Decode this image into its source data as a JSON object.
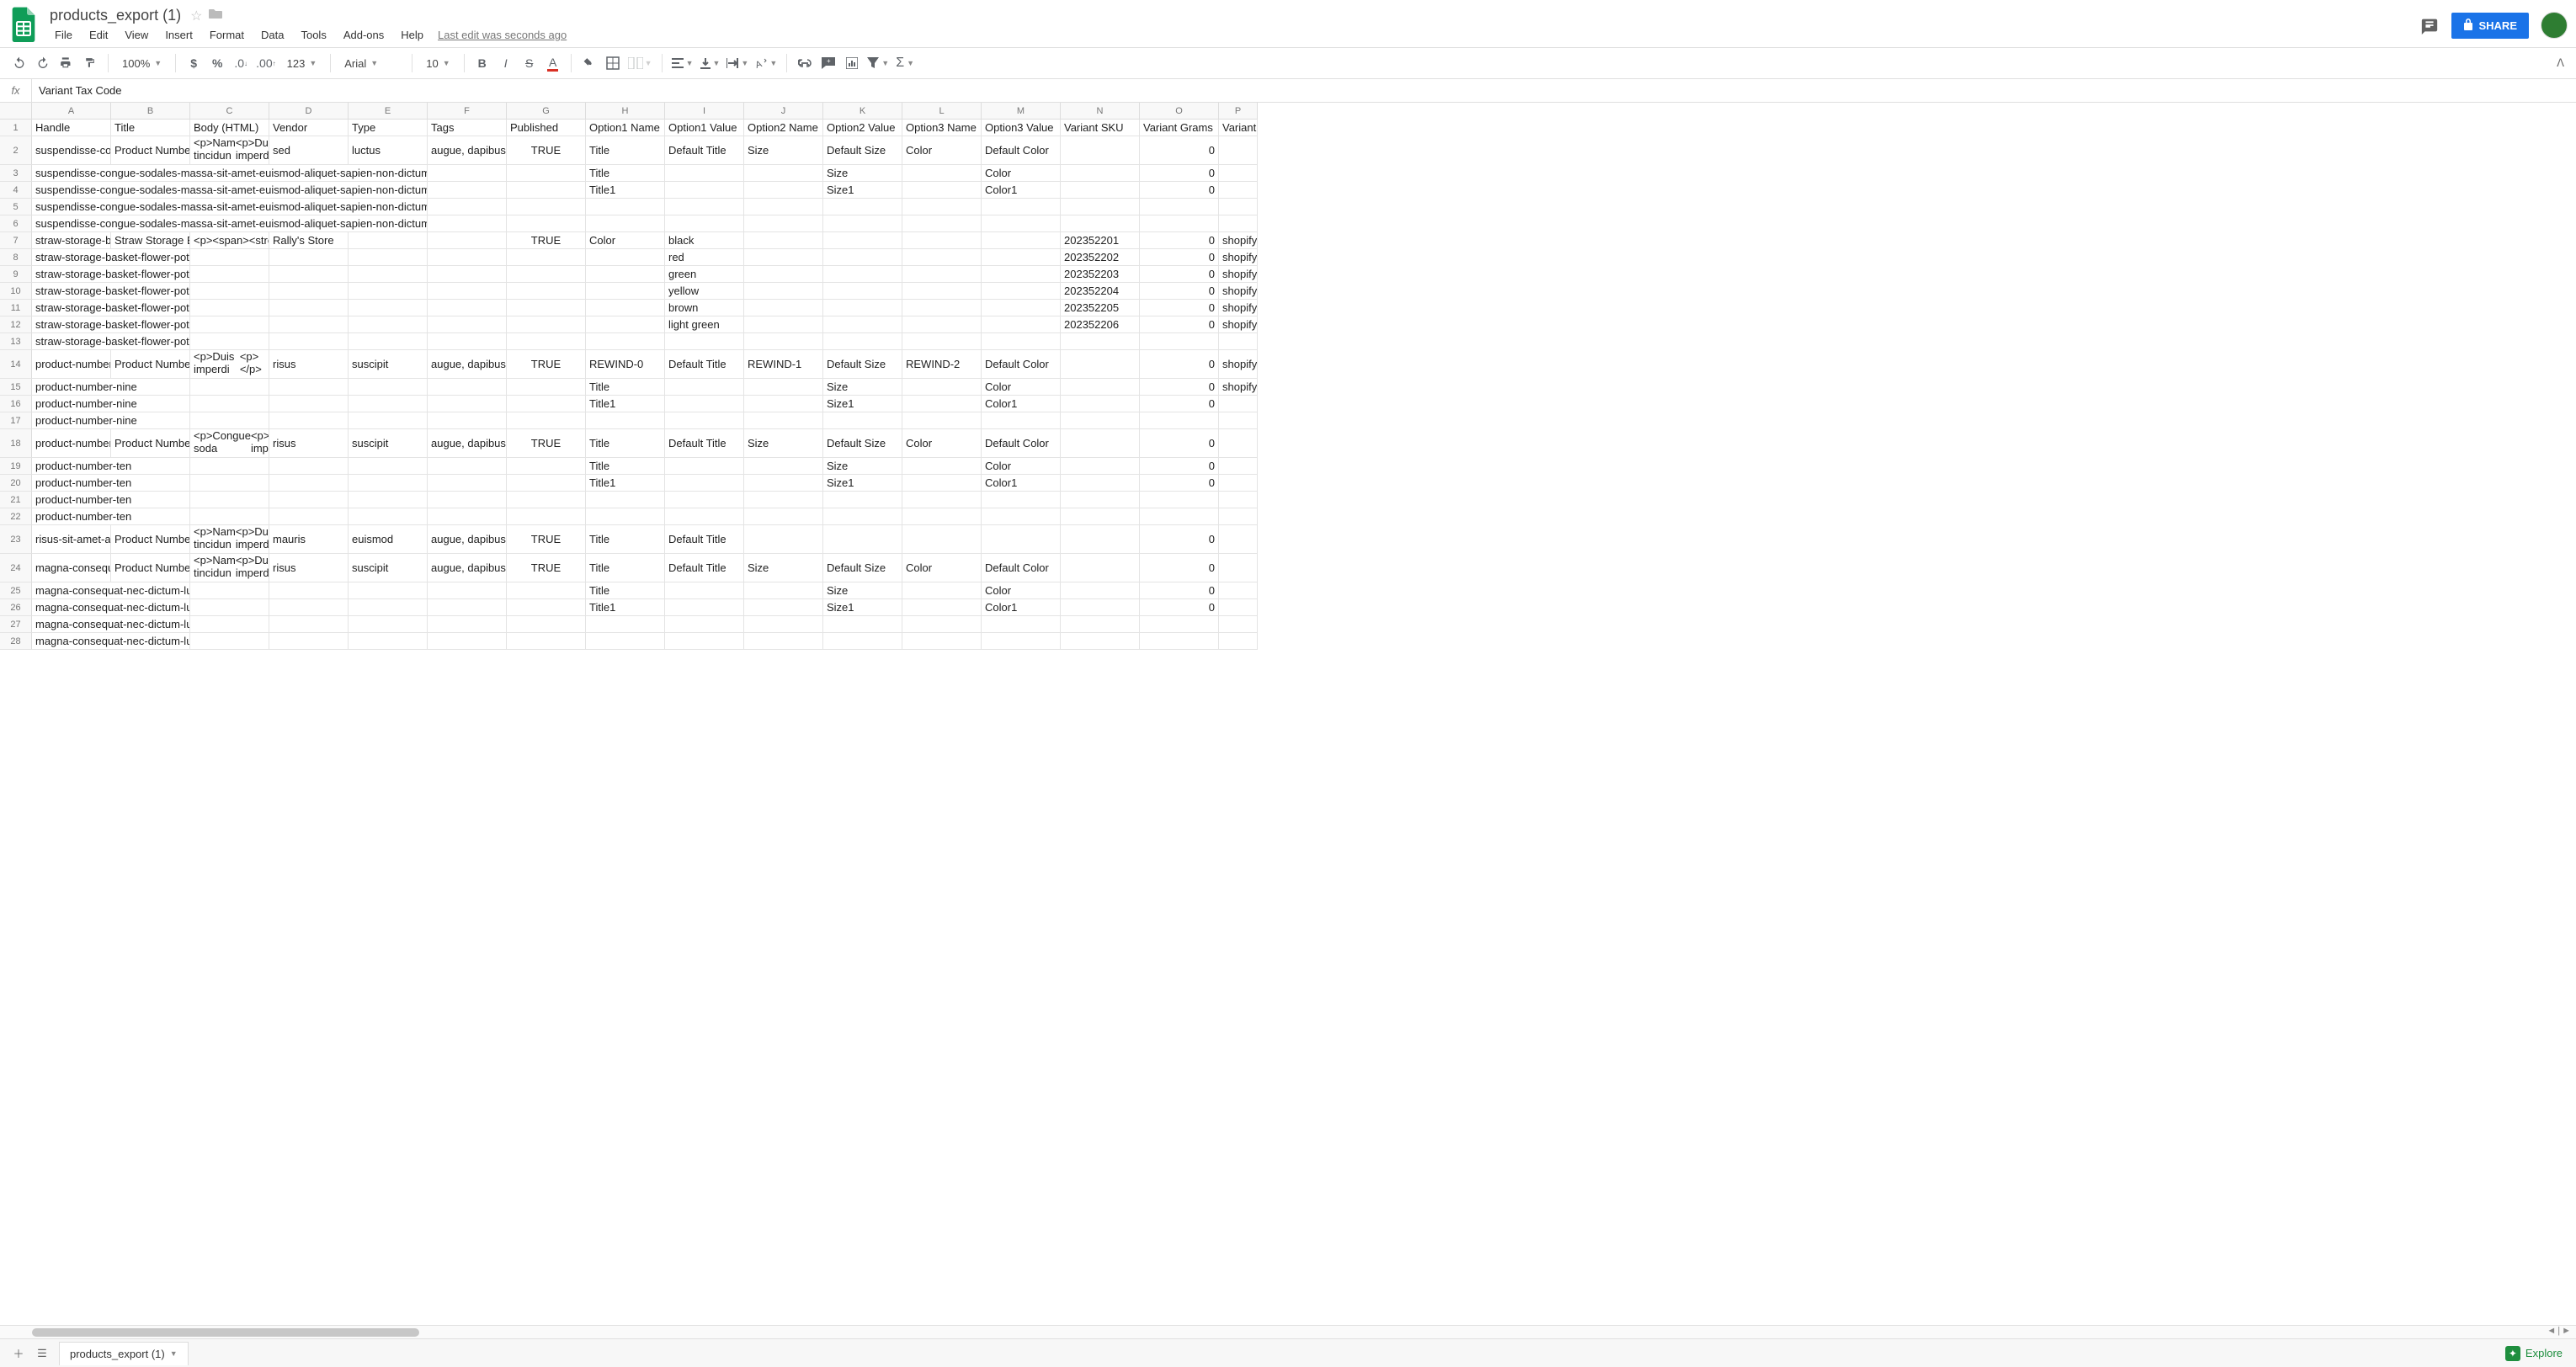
{
  "doc": {
    "title": "products_export (1)",
    "last_edit": "Last edit was seconds ago"
  },
  "menus": [
    "File",
    "Edit",
    "View",
    "Insert",
    "Format",
    "Data",
    "Tools",
    "Add-ons",
    "Help"
  ],
  "share_label": "SHARE",
  "toolbar": {
    "zoom": "100%",
    "font": "Arial",
    "font_size": "10",
    "num_fmt": "123"
  },
  "formula_bar": {
    "fx": "fx",
    "value": "Variant Tax Code"
  },
  "columns": [
    {
      "letter": "A",
      "label": "Handle",
      "w": 94
    },
    {
      "letter": "B",
      "label": "Title",
      "w": 94
    },
    {
      "letter": "C",
      "label": "Body (HTML)",
      "w": 94
    },
    {
      "letter": "D",
      "label": "Vendor",
      "w": 94
    },
    {
      "letter": "E",
      "label": "Type",
      "w": 94
    },
    {
      "letter": "F",
      "label": "Tags",
      "w": 94
    },
    {
      "letter": "G",
      "label": "Published",
      "w": 94
    },
    {
      "letter": "H",
      "label": "Option1 Name",
      "w": 94
    },
    {
      "letter": "I",
      "label": "Option1 Value",
      "w": 94
    },
    {
      "letter": "J",
      "label": "Option2 Name",
      "w": 94
    },
    {
      "letter": "K",
      "label": "Option2 Value",
      "w": 94
    },
    {
      "letter": "L",
      "label": "Option3 Name",
      "w": 94
    },
    {
      "letter": "M",
      "label": "Option3 Value",
      "w": 94
    },
    {
      "letter": "N",
      "label": "Variant SKU",
      "w": 94
    },
    {
      "letter": "O",
      "label": "Variant Grams",
      "w": 94
    },
    {
      "letter": "P",
      "label": "Variant I",
      "w": 46
    }
  ],
  "rowhead_w": 38,
  "rows": [
    {
      "n": 1,
      "h": 20,
      "header": true
    },
    {
      "n": 2,
      "h": 34,
      "cells": [
        "suspendisse-con",
        "Product Number",
        "<p>Nam tincidun\n<p>Duis imperdi",
        "sed",
        "luctus",
        "augue, dapibus,",
        "TRUE",
        "Title",
        "Default Title",
        "Size",
        "Default Size",
        "Color",
        "Default Color",
        "",
        "0",
        ""
      ]
    },
    {
      "n": 3,
      "h": 20,
      "cells": [
        "suspendisse-congue-sodales-massa-sit-amet-euismod-aliquet-sapien-non-dictum",
        "",
        "",
        "",
        "",
        "",
        "",
        "Title",
        "",
        "",
        "Size",
        "",
        "Color",
        "",
        "0",
        ""
      ],
      "span": 5
    },
    {
      "n": 4,
      "h": 20,
      "cells": [
        "suspendisse-congue-sodales-massa-sit-amet-euismod-aliquet-sapien-non-dictum",
        "",
        "",
        "",
        "",
        "",
        "",
        "Title1",
        "",
        "",
        "Size1",
        "",
        "Color1",
        "",
        "0",
        ""
      ],
      "span": 5
    },
    {
      "n": 5,
      "h": 20,
      "cells": [
        "suspendisse-congue-sodales-massa-sit-amet-euismod-aliquet-sapien-non-dictum",
        "",
        "",
        "",
        "",
        "",
        "",
        "",
        "",
        "",
        "",
        "",
        "",
        "",
        "",
        ""
      ],
      "span": 5
    },
    {
      "n": 6,
      "h": 20,
      "cells": [
        "suspendisse-congue-sodales-massa-sit-amet-euismod-aliquet-sapien-non-dictum",
        "",
        "",
        "",
        "",
        "",
        "",
        "",
        "",
        "",
        "",
        "",
        "",
        "",
        "",
        ""
      ],
      "span": 5
    },
    {
      "n": 7,
      "h": 20,
      "cells": [
        "straw-storage-ba",
        "Straw Storage Ba",
        "<p><span><stro",
        "Rally's Store",
        "",
        "",
        "TRUE",
        "Color",
        "black",
        "",
        "",
        "",
        "",
        "202352201",
        "0",
        "shopify"
      ]
    },
    {
      "n": 8,
      "h": 20,
      "cells": [
        "straw-storage-basket-flower-pot",
        "",
        "",
        "",
        "",
        "",
        "",
        "",
        "red",
        "",
        "",
        "",
        "",
        "202352202",
        "0",
        "shopify"
      ],
      "span": 2
    },
    {
      "n": 9,
      "h": 20,
      "cells": [
        "straw-storage-basket-flower-pot",
        "",
        "",
        "",
        "",
        "",
        "",
        "",
        "green",
        "",
        "",
        "",
        "",
        "202352203",
        "0",
        "shopify"
      ],
      "span": 2
    },
    {
      "n": 10,
      "h": 20,
      "cells": [
        "straw-storage-basket-flower-pot",
        "",
        "",
        "",
        "",
        "",
        "",
        "",
        "yellow",
        "",
        "",
        "",
        "",
        "202352204",
        "0",
        "shopify"
      ],
      "span": 2
    },
    {
      "n": 11,
      "h": 20,
      "cells": [
        "straw-storage-basket-flower-pot",
        "",
        "",
        "",
        "",
        "",
        "",
        "",
        "brown",
        "",
        "",
        "",
        "",
        "202352205",
        "0",
        "shopify"
      ],
      "span": 2
    },
    {
      "n": 12,
      "h": 20,
      "cells": [
        "straw-storage-basket-flower-pot",
        "",
        "",
        "",
        "",
        "",
        "",
        "",
        "light green",
        "",
        "",
        "",
        "",
        "202352206",
        "0",
        "shopify"
      ],
      "span": 2
    },
    {
      "n": 13,
      "h": 20,
      "cells": [
        "straw-storage-basket-flower-pot",
        "",
        "",
        "",
        "",
        "",
        "",
        "",
        "",
        "",
        "",
        "",
        "",
        "",
        "",
        ""
      ],
      "span": 2
    },
    {
      "n": 14,
      "h": 34,
      "cells": [
        "product-number-",
        "Product Number",
        "<p>Duis imperdi\n<p> </p>",
        "risus",
        "suscipit",
        "augue, dapibus,",
        "TRUE",
        "REWIND-0",
        "Default Title",
        "REWIND-1",
        "Default Size",
        "REWIND-2",
        "Default Color",
        "",
        "0",
        "shopify"
      ]
    },
    {
      "n": 15,
      "h": 20,
      "cells": [
        "product-number-nine",
        "",
        "",
        "",
        "",
        "",
        "",
        "Title",
        "",
        "",
        "Size",
        "",
        "Color",
        "",
        "0",
        "shopify"
      ],
      "span": 2
    },
    {
      "n": 16,
      "h": 20,
      "cells": [
        "product-number-nine",
        "",
        "",
        "",
        "",
        "",
        "",
        "Title1",
        "",
        "",
        "Size1",
        "",
        "Color1",
        "",
        "0",
        ""
      ],
      "span": 2
    },
    {
      "n": 17,
      "h": 20,
      "cells": [
        "product-number-nine",
        "",
        "",
        "",
        "",
        "",
        "",
        "",
        "",
        "",
        "",
        "",
        "",
        "",
        "",
        ""
      ],
      "span": 2
    },
    {
      "n": 18,
      "h": 34,
      "cells": [
        "product-number-",
        "Product Number",
        "<p>Congue soda\n<p>Duis imperdi",
        "risus",
        "suscipit",
        "augue, dapibus,",
        "TRUE",
        "Title",
        "Default Title",
        "Size",
        "Default Size",
        "Color",
        "Default Color",
        "",
        "0",
        ""
      ]
    },
    {
      "n": 19,
      "h": 20,
      "cells": [
        "product-number-ten",
        "",
        "",
        "",
        "",
        "",
        "",
        "Title",
        "",
        "",
        "Size",
        "",
        "Color",
        "",
        "0",
        ""
      ],
      "span": 2
    },
    {
      "n": 20,
      "h": 20,
      "cells": [
        "product-number-ten",
        "",
        "",
        "",
        "",
        "",
        "",
        "Title1",
        "",
        "",
        "Size1",
        "",
        "Color1",
        "",
        "0",
        ""
      ],
      "span": 2
    },
    {
      "n": 21,
      "h": 20,
      "cells": [
        "product-number-ten",
        "",
        "",
        "",
        "",
        "",
        "",
        "",
        "",
        "",
        "",
        "",
        "",
        "",
        "",
        ""
      ],
      "span": 2
    },
    {
      "n": 22,
      "h": 20,
      "cells": [
        "product-number-ten",
        "",
        "",
        "",
        "",
        "",
        "",
        "",
        "",
        "",
        "",
        "",
        "",
        "",
        "",
        ""
      ],
      "span": 2
    },
    {
      "n": 23,
      "h": 34,
      "cells": [
        "risus-sit-amet-an",
        "Product Number",
        "<p>Nam tincidun\n<p>Duis imperdi",
        "mauris",
        "euismod",
        "augue, dapibus,",
        "TRUE",
        "Title",
        "Default Title",
        "",
        "",
        "",
        "",
        "",
        "0",
        ""
      ]
    },
    {
      "n": 24,
      "h": 34,
      "cells": [
        "magna-consequa",
        "Product Number",
        "<p>Nam tincidun\n<p>Duis imperdi",
        "risus",
        "suscipit",
        "augue, dapibus,",
        "TRUE",
        "Title",
        "Default Title",
        "Size",
        "Default Size",
        "Color",
        "Default Color",
        "",
        "0",
        ""
      ]
    },
    {
      "n": 25,
      "h": 20,
      "cells": [
        "magna-consequat-nec-dictum-luctus",
        "",
        "",
        "",
        "",
        "",
        "",
        "Title",
        "",
        "",
        "Size",
        "",
        "Color",
        "",
        "0",
        ""
      ],
      "span": 2
    },
    {
      "n": 26,
      "h": 20,
      "cells": [
        "magna-consequat-nec-dictum-luctus",
        "",
        "",
        "",
        "",
        "",
        "",
        "Title1",
        "",
        "",
        "Size1",
        "",
        "Color1",
        "",
        "0",
        ""
      ],
      "span": 2
    },
    {
      "n": 27,
      "h": 20,
      "cells": [
        "magna-consequat-nec-dictum-luctus",
        "",
        "",
        "",
        "",
        "",
        "",
        "",
        "",
        "",
        "",
        "",
        "",
        "",
        "",
        ""
      ],
      "span": 2
    },
    {
      "n": 28,
      "h": 20,
      "cells": [
        "magna-consequat-nec-dictum-luctus",
        "",
        "",
        "",
        "",
        "",
        "",
        "",
        "",
        "",
        "",
        "",
        "",
        "",
        "",
        ""
      ],
      "span": 2
    }
  ],
  "sheet_tab": "products_export (1)",
  "explore_label": "Explore"
}
